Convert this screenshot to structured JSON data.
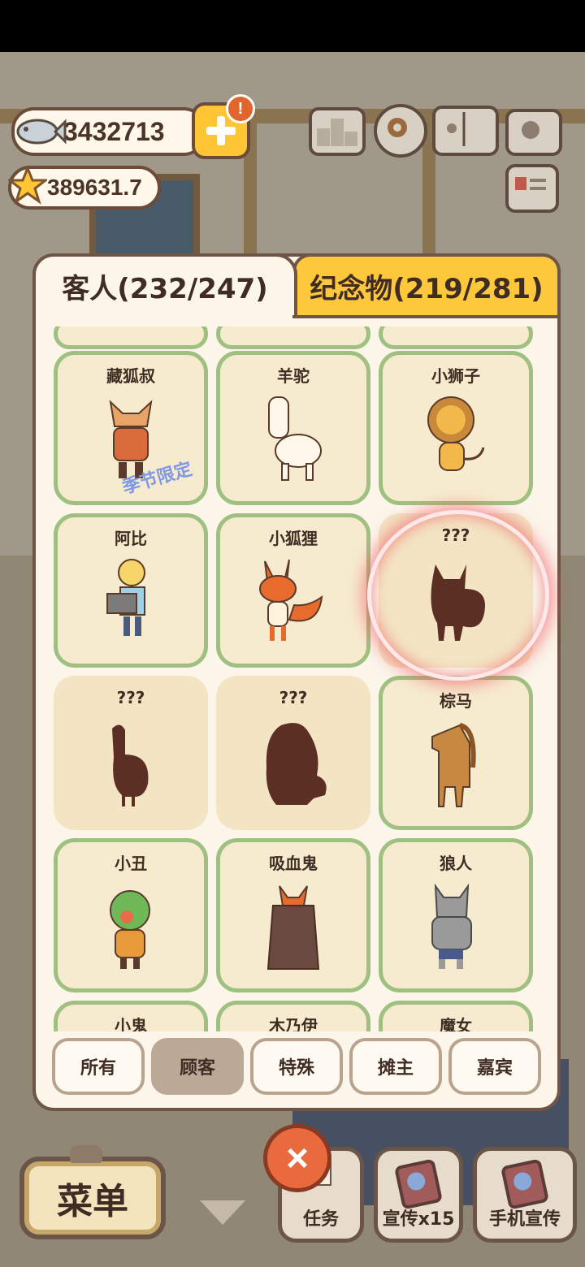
{
  "currency": {
    "fish": "3432713",
    "stars": "389631.7",
    "alert_badge": "!"
  },
  "toolbar_icons": [
    "ranking-icon",
    "settings-icon",
    "album-icon",
    "camera-icon",
    "id-card-icon"
  ],
  "tabs": {
    "guests": "客人(232/247)",
    "souvenirs": "纪念物(219/281)"
  },
  "guests": [
    {
      "name": "藏狐叔",
      "tag": "季节限定"
    },
    {
      "name": "羊驼"
    },
    {
      "name": "小狮子"
    },
    {
      "name": "阿比"
    },
    {
      "name": "小狐狸"
    },
    {
      "name": "???",
      "locked": true
    },
    {
      "name": "???",
      "locked": true
    },
    {
      "name": "???",
      "locked": true
    },
    {
      "name": "棕马"
    },
    {
      "name": "小丑"
    },
    {
      "name": "吸血鬼"
    },
    {
      "name": "狼人"
    },
    {
      "name": "小鬼"
    },
    {
      "name": "木乃伊"
    },
    {
      "name": "魔女"
    }
  ],
  "filters": [
    "所有",
    "顾客",
    "特殊",
    "摊主",
    "嘉宾"
  ],
  "active_filter": "顾客",
  "close_label": "×",
  "bottom": {
    "menu": "菜单",
    "tasks": "任务",
    "promo": "宣传x15",
    "phone_promo": "手机宣传"
  },
  "colors": {
    "panel_border": "#6e5546",
    "card_border": "#9fc080",
    "souvenir_tab": "#fdc83c",
    "close": "#e96a3d",
    "highlight": "#f0505a"
  }
}
